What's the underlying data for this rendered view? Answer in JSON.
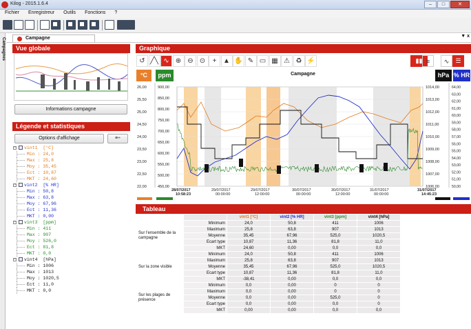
{
  "window": {
    "title": "Kilog - 2015.1.6.4",
    "min_icon": "minimize-icon",
    "max_icon": "maximize-icon",
    "close_icon": "close-icon"
  },
  "menu": [
    "Fichier",
    "Enregistreur",
    "Outils",
    "Fonctions",
    "?"
  ],
  "toolbar_icons": [
    "new-file-icon",
    "open-folder-icon",
    "save-icon",
    "print-preview-icon",
    "print-icon",
    "logger-read-icon",
    "logger-config-icon",
    "logger-settings-icon",
    "network-icon",
    "database-icon"
  ],
  "sidebar_tab": "Campagnes",
  "tab": {
    "label": "Campagne",
    "panel_options": "▼ x"
  },
  "vue_globale": {
    "title": "Vue globale",
    "button": "Informations campagne"
  },
  "legende": {
    "title": "Légende et statistiques",
    "options_button": "Options d'affichage",
    "options_icon": "list-settings-icon",
    "channels": [
      {
        "name": "vint1",
        "unit": "[°C]",
        "color": "#e07a1f",
        "stats": [
          "Min : 24,0",
          "Max : 25,8",
          "Moy : 35,45",
          "Ect : 10,87",
          "MKT : 24,60"
        ]
      },
      {
        "name": "vint2",
        "unit": "[% HR]",
        "color": "#1f2fc8",
        "stats": [
          "Min : 50,8",
          "Max : 63,8",
          "Moy : 67,96",
          "Ect : 11,36",
          "MKT : 0,00"
        ]
      },
      {
        "name": "vint3",
        "unit": "[ppm]",
        "color": "#2b8a2b",
        "stats": [
          "Min : 411",
          "Max : 907",
          "Moy : 526,0",
          "Ect : 81,8",
          "MKT : 0,0"
        ]
      },
      {
        "name": "vint4",
        "unit": "[hPa]",
        "color": "#222222",
        "stats": [
          "Min : 1006",
          "Max : 1013",
          "Moy : 1020,5",
          "Ect : 11,0",
          "MKT : 0,0"
        ]
      }
    ]
  },
  "graphique": {
    "title": "Graphique",
    "chart_title": "Campagne",
    "units_left": [
      "°C",
      "ppm"
    ],
    "units_right": [
      "hPa",
      "% HR"
    ],
    "unit_colors": {
      "°C": "#e8802a",
      "ppm": "#2b8a2b",
      "hPa": "#111111",
      "% HR": "#1f2fc8"
    },
    "axis_c": [
      "26,00",
      "25,50",
      "25,00",
      "24,50",
      "24,00",
      "23,50",
      "23,00",
      "22,50",
      "22,00"
    ],
    "axis_ppm": [
      "900,00",
      "850,00",
      "800,00",
      "750,00",
      "700,00",
      "650,00",
      "600,00",
      "550,00",
      "500,00",
      "450,00"
    ],
    "axis_hpa": [
      "1014,00",
      "1013,00",
      "1012,00",
      "1011,00",
      "1010,00",
      "1009,00",
      "1008,00",
      "1007,00",
      "1006,00"
    ],
    "axis_hr": [
      "64,00",
      "63,00",
      "62,00",
      "61,00",
      "60,00",
      "59,00",
      "58,00",
      "57,00",
      "56,00",
      "55,00",
      "54,00",
      "53,00",
      "52,00",
      "51,00",
      "50,00"
    ],
    "x_labels": [
      {
        "d": "28/07/2017",
        "t": "10:58:23",
        "bold": true
      },
      {
        "d": "29/07/2017",
        "t": "00:00:00"
      },
      {
        "d": "29/07/2017",
        "t": "12:00:00"
      },
      {
        "d": "30/07/2017",
        "t": "00:00:00"
      },
      {
        "d": "30/07/2017",
        "t": "12:00:00"
      },
      {
        "d": "31/07/2017",
        "t": "00:00:00"
      },
      {
        "d": "31/07/2017",
        "t": "14:45:23",
        "bold": true
      }
    ],
    "tool_icons": [
      "reset-zoom-icon",
      "line-mode-icon",
      "curve-mode-icon",
      "zoom-in-icon",
      "zoom-out-icon",
      "zoom-icon",
      "crosshair-icon",
      "pointer-icon",
      "hand-icon",
      "edit-icon",
      "window-icon",
      "bar-chart-icon",
      "alarm-icon",
      "recycle-icon",
      "zone-icon"
    ],
    "view_icons": [
      "split-view-icon",
      "table-view-icon",
      "line-view-icon",
      "area-view-icon"
    ]
  },
  "tableau": {
    "title": "Tableau",
    "headers": [
      "vint1 [°C]",
      "vint2 [% HR]",
      "vint3 [ppm]",
      "vint4 [hPa]"
    ],
    "header_colors": [
      "#e07a1f",
      "#1f2fc8",
      "#2b8a2b",
      "#111111"
    ],
    "groups": [
      {
        "label": "Sur l'ensemble de la campagne",
        "rows": [
          [
            "Minimum",
            "24,0",
            "50,8",
            "411",
            "1006"
          ],
          [
            "Maximum",
            "25,8",
            "63,8",
            "907",
            "1013"
          ],
          [
            "Moyenne",
            "35,45",
            "67,96",
            "525,0",
            "1020,5"
          ],
          [
            "Ecart type",
            "10,87",
            "11,36",
            "81,8",
            "11,0"
          ],
          [
            "MKT",
            "24,60",
            "0,00",
            "0,0",
            "0,0"
          ]
        ]
      },
      {
        "label": "Sur la zone visible",
        "rows": [
          [
            "Minimum",
            "24,0",
            "50,8",
            "411",
            "1006"
          ],
          [
            "Maximum",
            "25,8",
            "63,8",
            "907",
            "1013"
          ],
          [
            "Moyenne",
            "35,45",
            "67,96",
            "525,0",
            "1020,5"
          ],
          [
            "Ecart type",
            "10,87",
            "11,36",
            "81,8",
            "11,0"
          ],
          [
            "MKT",
            "-38,41",
            "0,00",
            "0,0",
            "0,0"
          ]
        ]
      },
      {
        "label": "Sur les plages de présence",
        "rows": [
          [
            "Minimum",
            "0,0",
            "0,00",
            "0",
            "0"
          ],
          [
            "Maximum",
            "0,0",
            "0,00",
            "0",
            "0"
          ],
          [
            "Moyenne",
            "0,0",
            "0,00",
            "525,0",
            "0"
          ],
          [
            "Ecart type",
            "0,0",
            "0,00",
            "0,0",
            "0"
          ],
          [
            "MKT",
            "0,00",
            "0,00",
            "0,0",
            "0,0"
          ]
        ]
      }
    ]
  }
}
